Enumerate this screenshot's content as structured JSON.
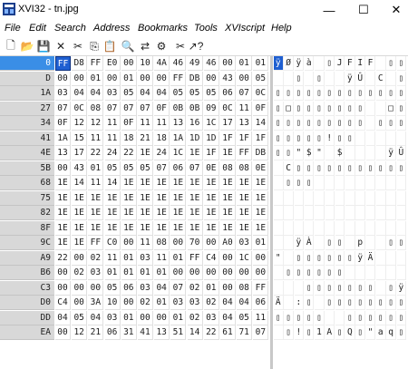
{
  "window": {
    "title": "XVI32 - tn.jpg",
    "minimize": "—",
    "maximize": "☐",
    "close": "✕"
  },
  "menu": [
    "File",
    "Edit",
    "Search",
    "Address",
    "Bookmarks",
    "Tools",
    "XVIscript",
    "Help"
  ],
  "toolbar": [
    {
      "name": "new-file-icon",
      "glyph": "🗋"
    },
    {
      "name": "open-icon",
      "glyph": "📂"
    },
    {
      "name": "save-icon",
      "glyph": "💾"
    },
    {
      "name": "delete-icon",
      "glyph": "✕"
    },
    {
      "name": "cut-icon",
      "glyph": "✂"
    },
    {
      "name": "copy-icon",
      "glyph": "⎘"
    },
    {
      "name": "paste-icon",
      "glyph": "📋"
    },
    {
      "name": "search-icon",
      "glyph": "🔍"
    },
    {
      "name": "replace-icon",
      "glyph": "⇄"
    },
    {
      "name": "properties-icon",
      "glyph": "⚙"
    },
    {
      "name": "script-icon",
      "glyph": "✂"
    },
    {
      "name": "help-icon",
      "glyph": "↗?"
    }
  ],
  "rows": [
    {
      "addr": "0",
      "hex": [
        "FF",
        "D8",
        "FF",
        "E0",
        "00",
        "10",
        "4A",
        "46",
        "49",
        "46",
        "00",
        "01",
        "01"
      ],
      "ascii": [
        "ÿ",
        "Ø",
        "ÿ",
        "à",
        "",
        "▯",
        "J",
        "F",
        "I",
        "F",
        "",
        "▯",
        "▯"
      ]
    },
    {
      "addr": "D",
      "hex": [
        "00",
        "00",
        "01",
        "00",
        "01",
        "00",
        "00",
        "FF",
        "DB",
        "00",
        "43",
        "00",
        "05"
      ],
      "ascii": [
        "",
        "",
        "▯",
        "",
        "▯",
        "",
        "",
        "ÿ",
        "Û",
        "",
        "C",
        "",
        "▯"
      ]
    },
    {
      "addr": "1A",
      "hex": [
        "03",
        "04",
        "04",
        "03",
        "05",
        "04",
        "04",
        "05",
        "05",
        "05",
        "06",
        "07",
        "0C"
      ],
      "ascii": [
        "▯",
        "▯",
        "▯",
        "▯",
        "▯",
        "▯",
        "▯",
        "▯",
        "▯",
        "▯",
        "▯",
        "▯",
        "▯"
      ]
    },
    {
      "addr": "27",
      "hex": [
        "07",
        "0C",
        "08",
        "07",
        "07",
        "07",
        "0F",
        "0B",
        "0B",
        "09",
        "0C",
        "11",
        "0F"
      ],
      "ascii": [
        "▯",
        "□",
        "▯",
        "▯",
        "▯",
        "▯",
        "▯",
        "▯",
        "▯",
        "",
        "",
        "□",
        "▯"
      ]
    },
    {
      "addr": "34",
      "hex": [
        "0F",
        "12",
        "12",
        "11",
        "0F",
        "11",
        "11",
        "13",
        "16",
        "1C",
        "17",
        "13",
        "14"
      ],
      "ascii": [
        "▯",
        "▯",
        "▯",
        "▯",
        "▯",
        "▯",
        "▯",
        "▯",
        "▯",
        "",
        "▯",
        "▯",
        "▯"
      ]
    },
    {
      "addr": "41",
      "hex": [
        "1A",
        "15",
        "11",
        "11",
        "18",
        "21",
        "18",
        "1A",
        "1D",
        "1D",
        "1F",
        "1F",
        "1F"
      ],
      "ascii": [
        "▯",
        "▯",
        "▯",
        "▯",
        "▯",
        "!",
        "▯",
        "▯",
        "",
        "",
        "",
        "",
        ""
      ]
    },
    {
      "addr": "4E",
      "hex": [
        "13",
        "17",
        "22",
        "24",
        "22",
        "1E",
        "24",
        "1C",
        "1E",
        "1F",
        "1E",
        "FF",
        "DB"
      ],
      "ascii": [
        "▯",
        "▯",
        "\"",
        "$",
        "\"",
        "",
        "$",
        "",
        "",
        "",
        "",
        "ÿ",
        "Û"
      ]
    },
    {
      "addr": "5B",
      "hex": [
        "00",
        "43",
        "01",
        "05",
        "05",
        "05",
        "07",
        "06",
        "07",
        "0E",
        "08",
        "08",
        "0E"
      ],
      "ascii": [
        "",
        "C",
        "▯",
        "▯",
        "▯",
        "▯",
        "▯",
        "▯",
        "▯",
        "▯",
        "▯",
        "▯",
        "▯"
      ]
    },
    {
      "addr": "68",
      "hex": [
        "1E",
        "14",
        "11",
        "14",
        "1E",
        "1E",
        "1E",
        "1E",
        "1E",
        "1E",
        "1E",
        "1E",
        "1E"
      ],
      "ascii": [
        "",
        "▯",
        "▯",
        "▯",
        "",
        "",
        "",
        "",
        "",
        "",
        "",
        "",
        ""
      ]
    },
    {
      "addr": "75",
      "hex": [
        "1E",
        "1E",
        "1E",
        "1E",
        "1E",
        "1E",
        "1E",
        "1E",
        "1E",
        "1E",
        "1E",
        "1E",
        "1E"
      ],
      "ascii": [
        "",
        "",
        "",
        "",
        "",
        "",
        "",
        "",
        "",
        "",
        "",
        "",
        ""
      ]
    },
    {
      "addr": "82",
      "hex": [
        "1E",
        "1E",
        "1E",
        "1E",
        "1E",
        "1E",
        "1E",
        "1E",
        "1E",
        "1E",
        "1E",
        "1E",
        "1E"
      ],
      "ascii": [
        "",
        "",
        "",
        "",
        "",
        "",
        "",
        "",
        "",
        "",
        "",
        "",
        ""
      ]
    },
    {
      "addr": "8F",
      "hex": [
        "1E",
        "1E",
        "1E",
        "1E",
        "1E",
        "1E",
        "1E",
        "1E",
        "1E",
        "1E",
        "1E",
        "1E",
        "1E"
      ],
      "ascii": [
        "",
        "",
        "",
        "",
        "",
        "",
        "",
        "",
        "",
        "",
        "",
        "",
        ""
      ]
    },
    {
      "addr": "9C",
      "hex": [
        "1E",
        "1E",
        "FF",
        "C0",
        "00",
        "11",
        "08",
        "00",
        "70",
        "00",
        "A0",
        "03",
        "01"
      ],
      "ascii": [
        "",
        "",
        "ÿ",
        "À",
        "",
        "▯",
        "▯",
        "",
        "p",
        "",
        "",
        "▯",
        "▯"
      ]
    },
    {
      "addr": "A9",
      "hex": [
        "22",
        "00",
        "02",
        "11",
        "01",
        "03",
        "11",
        "01",
        "FF",
        "C4",
        "00",
        "1C",
        "00"
      ],
      "ascii": [
        "\"",
        "",
        "▯",
        "▯",
        "▯",
        "▯",
        "▯",
        "▯",
        "ÿ",
        "Ä",
        "",
        "",
        ""
      ]
    },
    {
      "addr": "B6",
      "hex": [
        "00",
        "02",
        "03",
        "01",
        "01",
        "01",
        "01",
        "00",
        "00",
        "00",
        "00",
        "00",
        "00"
      ],
      "ascii": [
        "",
        "▯",
        "▯",
        "▯",
        "▯",
        "▯",
        "▯",
        "",
        "",
        "",
        "",
        "",
        ""
      ]
    },
    {
      "addr": "C3",
      "hex": [
        "00",
        "00",
        "00",
        "05",
        "06",
        "03",
        "04",
        "07",
        "02",
        "01",
        "00",
        "08",
        "FF"
      ],
      "ascii": [
        "",
        "",
        "",
        "▯",
        "▯",
        "▯",
        "▯",
        "▯",
        "▯",
        "▯",
        "",
        "▯",
        "ÿ"
      ]
    },
    {
      "addr": "D0",
      "hex": [
        "C4",
        "00",
        "3A",
        "10",
        "00",
        "02",
        "01",
        "03",
        "03",
        "02",
        "04",
        "04",
        "06"
      ],
      "ascii": [
        "Ä",
        "",
        ":",
        "▯",
        "",
        "▯",
        "▯",
        "▯",
        "▯",
        "▯",
        "▯",
        "▯",
        "▯"
      ]
    },
    {
      "addr": "DD",
      "hex": [
        "04",
        "05",
        "04",
        "03",
        "01",
        "00",
        "00",
        "01",
        "02",
        "03",
        "04",
        "05",
        "11"
      ],
      "ascii": [
        "▯",
        "▯",
        "▯",
        "▯",
        "▯",
        "",
        "",
        "▯",
        "▯",
        "▯",
        "▯",
        "▯",
        "▯"
      ]
    },
    {
      "addr": "EA",
      "hex": [
        "00",
        "12",
        "21",
        "06",
        "31",
        "41",
        "13",
        "51",
        "14",
        "22",
        "61",
        "71",
        "07"
      ],
      "ascii": [
        "",
        "▯",
        "!",
        "▯",
        "1",
        "A",
        "▯",
        "Q",
        "▯",
        "\"",
        "a",
        "q",
        "▯"
      ]
    }
  ],
  "selection": {
    "row": 0,
    "col": 0
  },
  "colors": {
    "selection": "#1f5fd1",
    "address_bg": "#d8d8d8"
  }
}
